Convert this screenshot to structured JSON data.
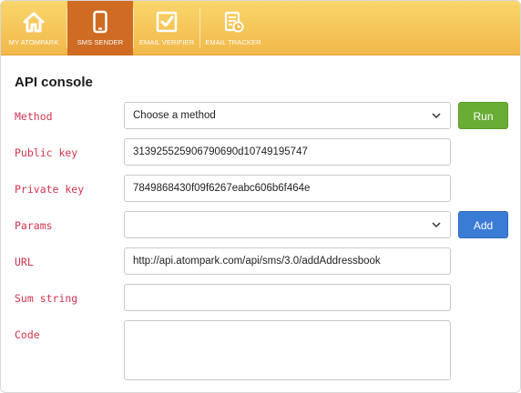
{
  "nav": {
    "tabs": [
      {
        "label": "MY ATOMPARK",
        "icon": "home-icon",
        "active": false
      },
      {
        "label": "SMS SENDER",
        "icon": "mobile-phone-icon",
        "active": true
      },
      {
        "label": "EMAIL VERIFIER",
        "icon": "checkbox-icon",
        "active": false
      },
      {
        "label": "EMAIL TRACKER",
        "icon": "tracker-document-icon",
        "active": false
      }
    ],
    "colors": {
      "bar": "#f2b84a",
      "active": "#cf6b22"
    }
  },
  "console": {
    "title": "API console",
    "fields": {
      "method": {
        "label": "Method",
        "value": "Choose a method"
      },
      "public_key": {
        "label": "Public key",
        "value": "313925525906790690d10749195747"
      },
      "private_key": {
        "label": "Private key",
        "value": "7849868430f09f6267eabc606b6f464e"
      },
      "params": {
        "label": "Params",
        "value": ""
      },
      "url": {
        "label": "URL",
        "value": "http://api.atompark.com/api/sms/3.0/addAddressbook"
      },
      "sum_string": {
        "label": "Sum string",
        "value": ""
      },
      "code": {
        "label": "Code",
        "value": ""
      }
    },
    "buttons": {
      "run": "Run",
      "add": "Add"
    },
    "colors": {
      "label": "#d0354f",
      "run": "#6aad35",
      "add": "#3a7bd5"
    }
  }
}
